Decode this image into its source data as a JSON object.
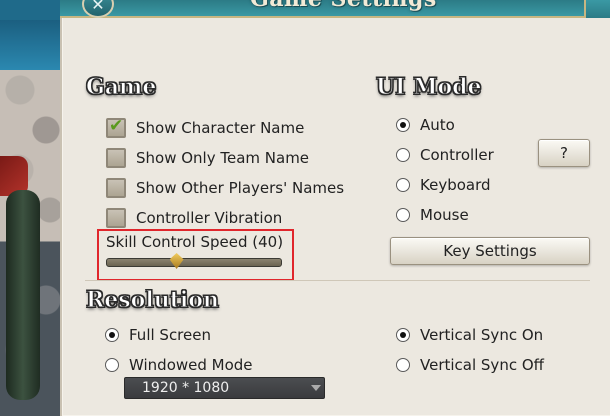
{
  "window": {
    "title": "Game Settings",
    "close_symbol": "✕"
  },
  "game": {
    "heading": "Game",
    "options": [
      {
        "label": "Show Character Name",
        "checked": true
      },
      {
        "label": "Show Only Team Name",
        "checked": false
      },
      {
        "label": "Show Other Players' Names",
        "checked": false
      },
      {
        "label": "Controller Vibration",
        "checked": false
      }
    ],
    "skill_speed": {
      "label": "Skill Control Speed (40)",
      "value": 40,
      "min": 0,
      "max": 100
    }
  },
  "ui_mode": {
    "heading": "UI Mode",
    "options": [
      {
        "label": "Auto",
        "selected": true
      },
      {
        "label": "Controller",
        "selected": false
      },
      {
        "label": "Keyboard",
        "selected": false
      },
      {
        "label": "Mouse",
        "selected": false
      }
    ],
    "help_button": "?",
    "key_settings_button": "Key Settings"
  },
  "resolution": {
    "heading": "Resolution",
    "display_options": [
      {
        "label": "Full Screen",
        "selected": true
      },
      {
        "label": "Windowed Mode",
        "selected": false
      }
    ],
    "vsync_options": [
      {
        "label": "Vertical Sync On",
        "selected": true
      },
      {
        "label": "Vertical Sync Off",
        "selected": false
      }
    ],
    "selected_resolution": "1920 * 1080"
  },
  "colors": {
    "highlight": "#e0262c",
    "title_bar": "#2c7b86",
    "panel": "#ece8e0"
  }
}
